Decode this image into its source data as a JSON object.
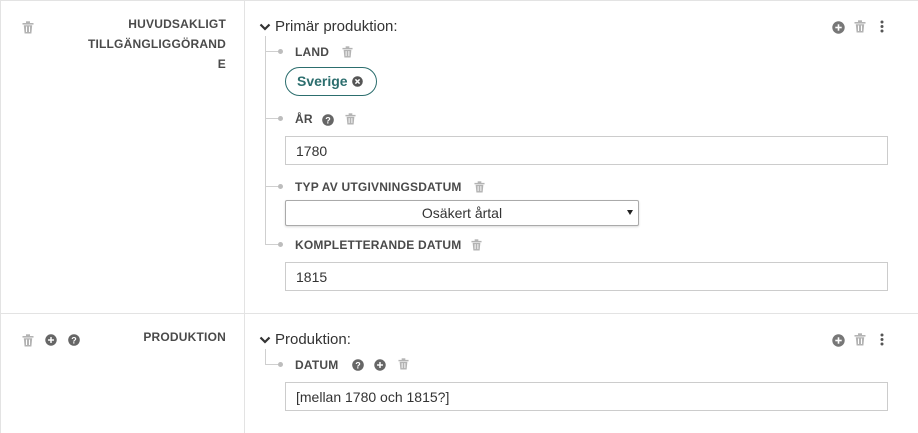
{
  "colors": {
    "icon_gray": "#b3b3b3",
    "icon_dark": "#777777",
    "tag_teal": "#2c6e6e",
    "border": "#e3e3e3"
  },
  "rows": [
    {
      "field_label": "HUVUDSAKLIGT TILLGÄNGLIGGÖRANDE",
      "field_label_lines": [
        "HUVUDSAKLIGT",
        "TILLGÄNGLIGGÖRAND",
        "E"
      ],
      "group_title": "Primär produktion:",
      "entries": [
        {
          "label": "LAND",
          "tag": "Sverige"
        },
        {
          "label": "ÅR",
          "value": "1780"
        },
        {
          "label": "TYP AV UTGIVNINGSDATUM",
          "selected": "Osäkert årtal"
        },
        {
          "label": "KOMPLETTERANDE DATUM",
          "value": "1815"
        }
      ]
    },
    {
      "field_label": "PRODUKTION",
      "group_title": "Produktion:",
      "entries": [
        {
          "label": "DATUM",
          "value": "[mellan 1780 och 1815?]"
        }
      ]
    }
  ],
  "icons": [
    "trash-icon",
    "plus-circle-icon",
    "question-circle-icon",
    "more-vertical-icon",
    "chevron-down-icon",
    "remove-circle-icon",
    "dropdown-caret-icon"
  ]
}
